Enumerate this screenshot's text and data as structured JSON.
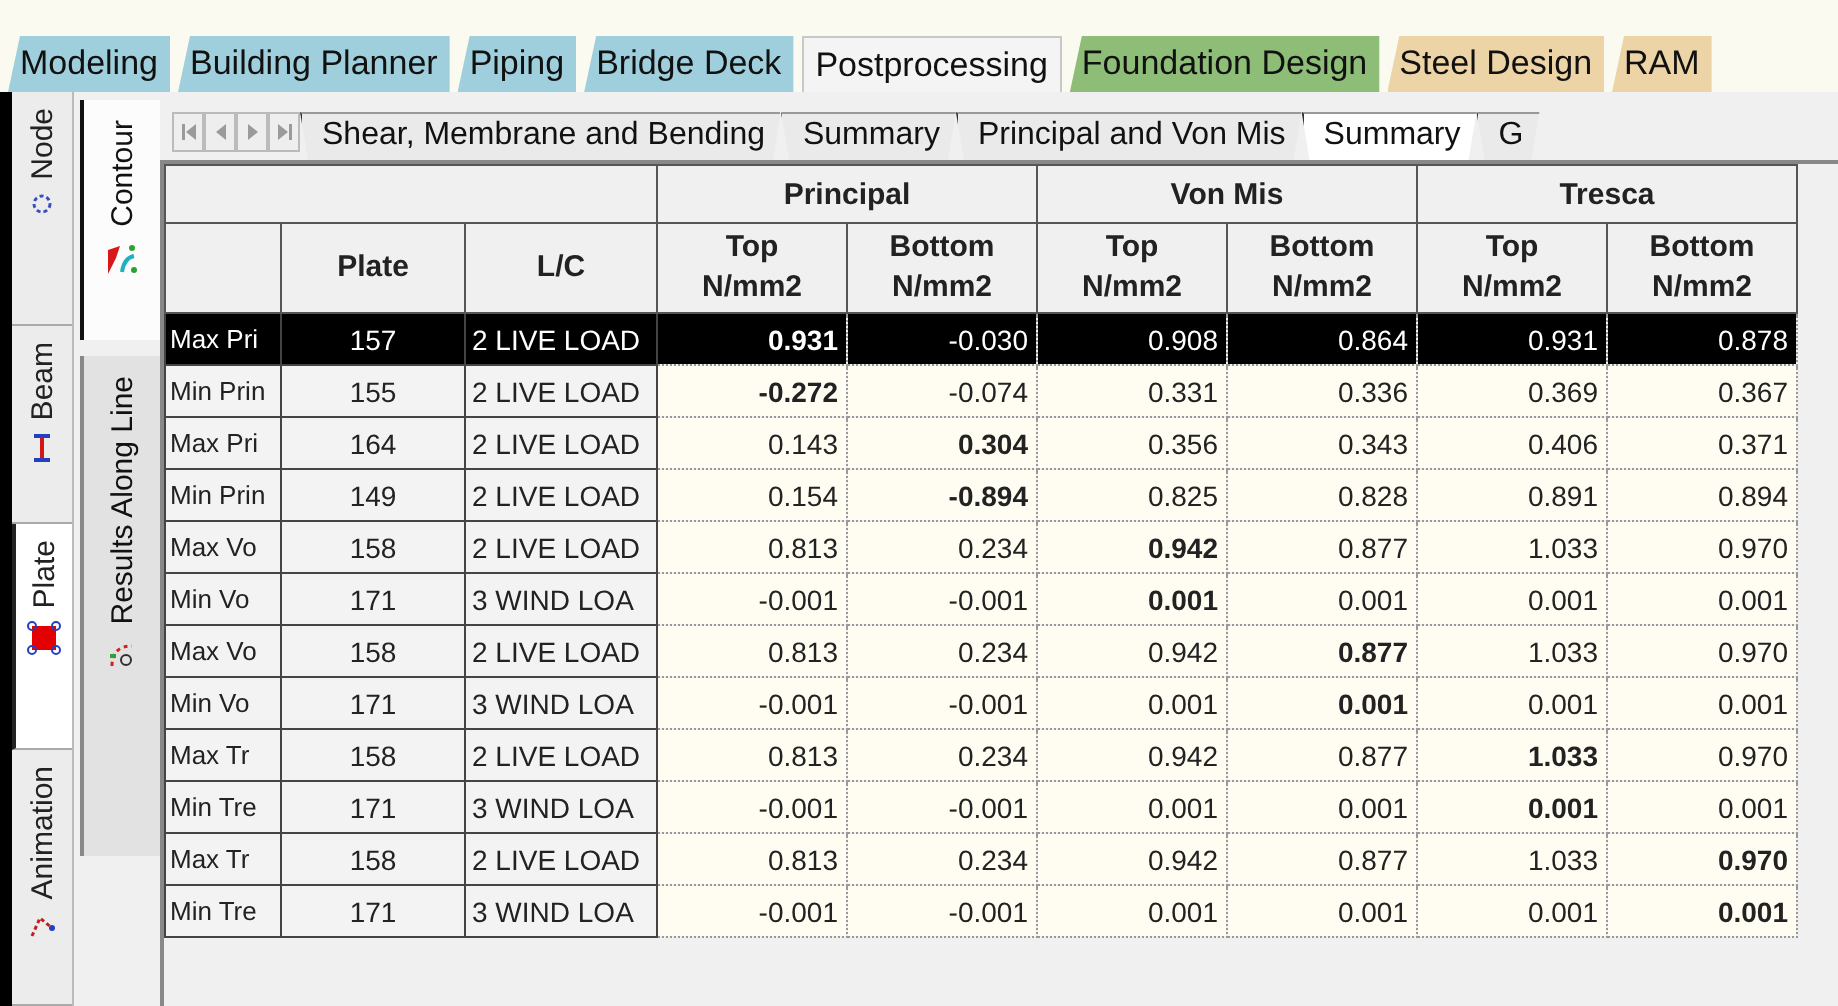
{
  "top_tabs": [
    {
      "label": "Modeling",
      "color": "#9fcfdc",
      "selected": false
    },
    {
      "label": "Building Planner",
      "color": "#9fcfdc",
      "selected": false
    },
    {
      "label": "Piping",
      "color": "#9fcfdc",
      "selected": false
    },
    {
      "label": "Bridge Deck",
      "color": "#9fcfdc",
      "selected": false
    },
    {
      "label": "Postprocessing",
      "color": "#f4f4f4",
      "selected": true
    },
    {
      "label": "Foundation Design",
      "color": "#8dbd76",
      "selected": false
    },
    {
      "label": "Steel Design",
      "color": "#ecd4a6",
      "selected": false
    },
    {
      "label": "RAM",
      "color": "#ecd4a6",
      "selected": false
    }
  ],
  "side_tabs": [
    {
      "label": "Node",
      "kind": "node",
      "selected": false
    },
    {
      "label": "Beam",
      "kind": "beam",
      "selected": false
    },
    {
      "label": "Plate",
      "kind": "plate",
      "selected": true
    },
    {
      "label": "Animation",
      "kind": "animation",
      "selected": false
    }
  ],
  "view_tabs": [
    {
      "label": "Contour",
      "kind": "contour",
      "selected": true
    },
    {
      "label": "Results Along Line",
      "kind": "line",
      "selected": false
    }
  ],
  "sheet_tabs": [
    {
      "label": "Shear, Membrane and Bending",
      "selected": false
    },
    {
      "label": "Summary",
      "selected": false
    },
    {
      "label": "Principal and Von Mis",
      "selected": false
    },
    {
      "label": "Summary",
      "selected": true
    },
    {
      "label": "G",
      "selected": false
    }
  ],
  "table": {
    "groups": [
      "Principal",
      "Von Mis",
      "Tresca"
    ],
    "columns": [
      "Plate",
      "L/C",
      "Top\nN/mm2",
      "Bottom\nN/mm2",
      "Top\nN/mm2",
      "Bottom\nN/mm2",
      "Top\nN/mm2",
      "Bottom\nN/mm2"
    ],
    "rows": [
      {
        "label": "Max Pri",
        "plate": "157",
        "lc": "2 LIVE LOAD",
        "selected": true,
        "values": [
          {
            "text": "0.931",
            "bold": true
          },
          {
            "text": "-0.030",
            "bold": false
          },
          {
            "text": "0.908",
            "bold": false
          },
          {
            "text": "0.864",
            "bold": false
          },
          {
            "text": "0.931",
            "bold": false
          },
          {
            "text": "0.878",
            "bold": false
          }
        ]
      },
      {
        "label": "Min Prin",
        "plate": "155",
        "lc": "2 LIVE LOAD",
        "selected": false,
        "values": [
          {
            "text": "-0.272",
            "bold": true
          },
          {
            "text": "-0.074",
            "bold": false
          },
          {
            "text": "0.331",
            "bold": false
          },
          {
            "text": "0.336",
            "bold": false
          },
          {
            "text": "0.369",
            "bold": false
          },
          {
            "text": "0.367",
            "bold": false
          }
        ]
      },
      {
        "label": "Max Pri",
        "plate": "164",
        "lc": "2 LIVE LOAD",
        "selected": false,
        "values": [
          {
            "text": "0.143",
            "bold": false
          },
          {
            "text": "0.304",
            "bold": true
          },
          {
            "text": "0.356",
            "bold": false
          },
          {
            "text": "0.343",
            "bold": false
          },
          {
            "text": "0.406",
            "bold": false
          },
          {
            "text": "0.371",
            "bold": false
          }
        ]
      },
      {
        "label": "Min Prin",
        "plate": "149",
        "lc": "2 LIVE LOAD",
        "selected": false,
        "values": [
          {
            "text": "0.154",
            "bold": false
          },
          {
            "text": "-0.894",
            "bold": true
          },
          {
            "text": "0.825",
            "bold": false
          },
          {
            "text": "0.828",
            "bold": false
          },
          {
            "text": "0.891",
            "bold": false
          },
          {
            "text": "0.894",
            "bold": false
          }
        ]
      },
      {
        "label": "Max Vo",
        "plate": "158",
        "lc": "2 LIVE LOAD",
        "selected": false,
        "values": [
          {
            "text": "0.813",
            "bold": false
          },
          {
            "text": "0.234",
            "bold": false
          },
          {
            "text": "0.942",
            "bold": true
          },
          {
            "text": "0.877",
            "bold": false
          },
          {
            "text": "1.033",
            "bold": false
          },
          {
            "text": "0.970",
            "bold": false
          }
        ]
      },
      {
        "label": "Min Vo",
        "plate": "171",
        "lc": "3 WIND LOA",
        "selected": false,
        "values": [
          {
            "text": "-0.001",
            "bold": false
          },
          {
            "text": "-0.001",
            "bold": false
          },
          {
            "text": "0.001",
            "bold": true
          },
          {
            "text": "0.001",
            "bold": false
          },
          {
            "text": "0.001",
            "bold": false
          },
          {
            "text": "0.001",
            "bold": false
          }
        ]
      },
      {
        "label": "Max Vo",
        "plate": "158",
        "lc": "2 LIVE LOAD",
        "selected": false,
        "values": [
          {
            "text": "0.813",
            "bold": false
          },
          {
            "text": "0.234",
            "bold": false
          },
          {
            "text": "0.942",
            "bold": false
          },
          {
            "text": "0.877",
            "bold": true
          },
          {
            "text": "1.033",
            "bold": false
          },
          {
            "text": "0.970",
            "bold": false
          }
        ]
      },
      {
        "label": "Min Vo",
        "plate": "171",
        "lc": "3 WIND LOA",
        "selected": false,
        "values": [
          {
            "text": "-0.001",
            "bold": false
          },
          {
            "text": "-0.001",
            "bold": false
          },
          {
            "text": "0.001",
            "bold": false
          },
          {
            "text": "0.001",
            "bold": true
          },
          {
            "text": "0.001",
            "bold": false
          },
          {
            "text": "0.001",
            "bold": false
          }
        ]
      },
      {
        "label": "Max Tr",
        "plate": "158",
        "lc": "2 LIVE LOAD",
        "selected": false,
        "values": [
          {
            "text": "0.813",
            "bold": false
          },
          {
            "text": "0.234",
            "bold": false
          },
          {
            "text": "0.942",
            "bold": false
          },
          {
            "text": "0.877",
            "bold": false
          },
          {
            "text": "1.033",
            "bold": true
          },
          {
            "text": "0.970",
            "bold": false
          }
        ]
      },
      {
        "label": "Min Tre",
        "plate": "171",
        "lc": "3 WIND LOA",
        "selected": false,
        "values": [
          {
            "text": "-0.001",
            "bold": false
          },
          {
            "text": "-0.001",
            "bold": false
          },
          {
            "text": "0.001",
            "bold": false
          },
          {
            "text": "0.001",
            "bold": false
          },
          {
            "text": "0.001",
            "bold": true
          },
          {
            "text": "0.001",
            "bold": false
          }
        ]
      },
      {
        "label": "Max Tr",
        "plate": "158",
        "lc": "2 LIVE LOAD",
        "selected": false,
        "values": [
          {
            "text": "0.813",
            "bold": false
          },
          {
            "text": "0.234",
            "bold": false
          },
          {
            "text": "0.942",
            "bold": false
          },
          {
            "text": "0.877",
            "bold": false
          },
          {
            "text": "1.033",
            "bold": false
          },
          {
            "text": "0.970",
            "bold": true
          }
        ]
      },
      {
        "label": "Min Tre",
        "plate": "171",
        "lc": "3 WIND LOA",
        "selected": false,
        "values": [
          {
            "text": "-0.001",
            "bold": false
          },
          {
            "text": "-0.001",
            "bold": false
          },
          {
            "text": "0.001",
            "bold": false
          },
          {
            "text": "0.001",
            "bold": false
          },
          {
            "text": "0.001",
            "bold": false
          },
          {
            "text": "0.001",
            "bold": true
          }
        ]
      }
    ]
  }
}
